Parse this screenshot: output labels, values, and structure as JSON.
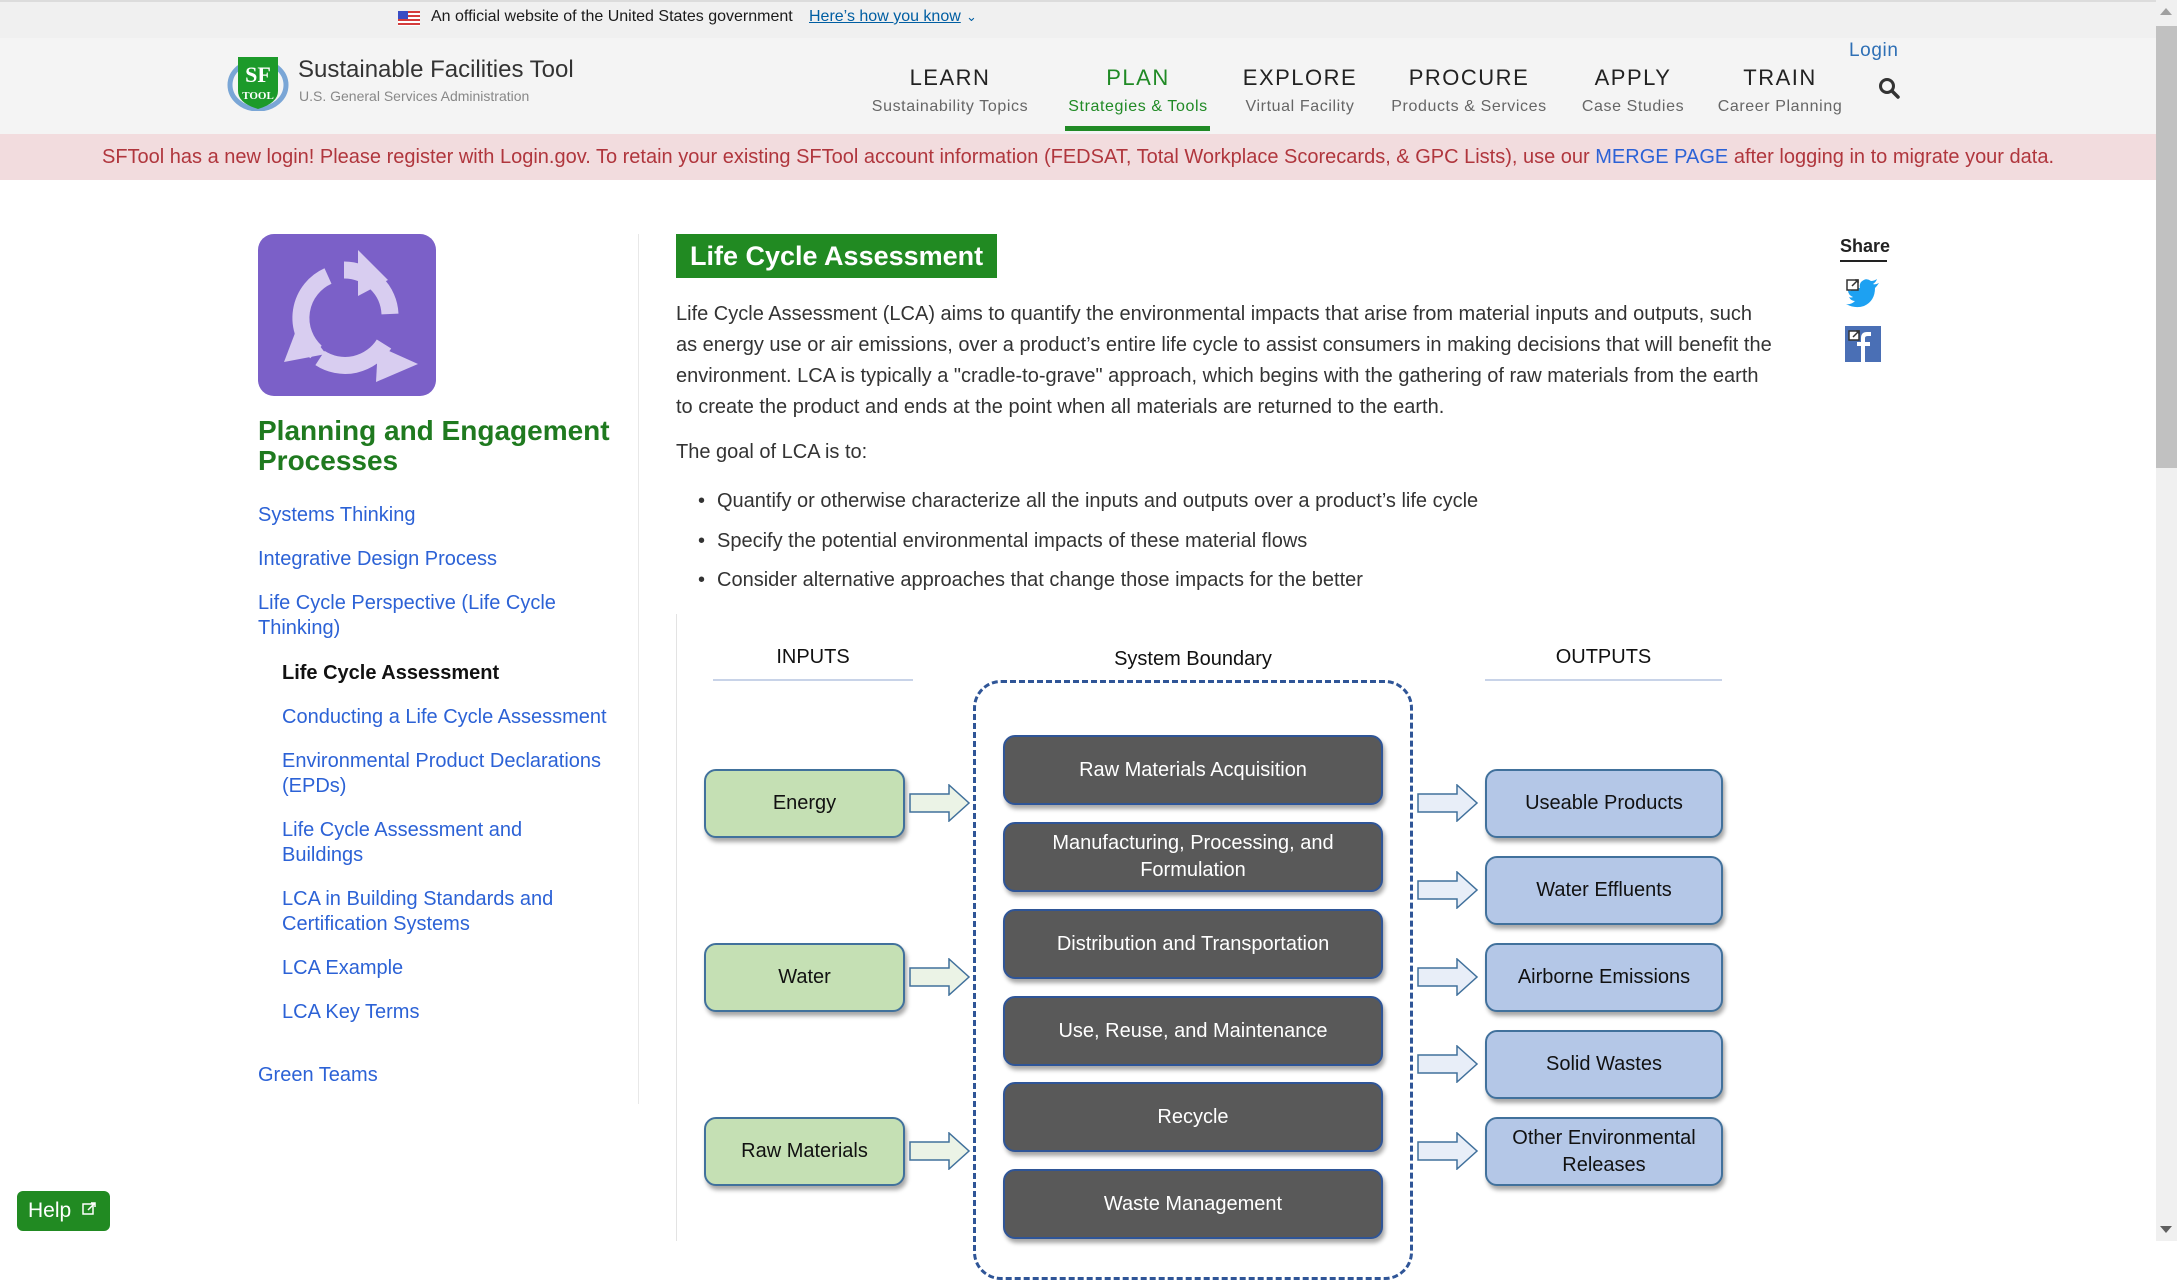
{
  "gov_banner": {
    "text": "An official website of the United States government",
    "link": "Here’s how you know",
    "chevron": "⌄"
  },
  "header": {
    "title": "Sustainable Facilities Tool",
    "subtitle": "U.S. General Services Administration",
    "login": "Login",
    "nav": [
      {
        "label": "LEARN",
        "sub": "Sustainability Topics"
      },
      {
        "label": "PLAN",
        "sub": "Strategies & Tools",
        "active": true
      },
      {
        "label": "EXPLORE",
        "sub": "Virtual Facility"
      },
      {
        "label": "PROCURE",
        "sub": "Products & Services"
      },
      {
        "label": "APPLY",
        "sub": "Case Studies"
      },
      {
        "label": "TRAIN",
        "sub": "Career Planning"
      }
    ]
  },
  "alert": {
    "text_before": "SFTool has a new login! Please register with Login.gov. To retain your existing SFTool account information (FEDSAT, Total Workplace Scorecards, & GPC Lists), use our ",
    "link": "MERGE PAGE",
    "text_after": " after logging in to migrate your data."
  },
  "sidebar": {
    "heading": "Planning and Engagement Processes",
    "items": [
      {
        "label": "Systems Thinking",
        "level": 1
      },
      {
        "label": "Integrative Design Process",
        "level": 1
      },
      {
        "label": "Life Cycle Perspective (Life Cycle Thinking)",
        "level": 1
      },
      {
        "label": "Life Cycle Assessment",
        "level": 2,
        "current": true
      },
      {
        "label": "Conducting a Life Cycle Assessment",
        "level": 2
      },
      {
        "label": "Environmental Product Declarations (EPDs)",
        "level": 2
      },
      {
        "label": "Life Cycle Assessment and Buildings",
        "level": 2
      },
      {
        "label": "LCA in Building Standards and Certification Systems",
        "level": 2
      },
      {
        "label": "LCA Example",
        "level": 2
      },
      {
        "label": "LCA Key Terms",
        "level": 2
      },
      {
        "label": "Green Teams",
        "level": 1
      }
    ]
  },
  "main": {
    "title": "Life Cycle Assessment",
    "intro": "Life Cycle Assessment (LCA) aims to quantify the environmental impacts that arise from material inputs and outputs, such as energy use or air emissions, over a product’s entire life cycle to assist consumers in making decisions that will benefit the environment. LCA is typically a \"cradle-to-grave\" approach, which begins with the gathering of raw materials from the earth to create the product and ends at the point when all materials are returned to the earth.",
    "goal_intro": "The goal of LCA is to:",
    "goals": [
      "Quantify or otherwise characterize all the inputs and outputs over a product’s life cycle",
      "Specify the potential environmental impacts of these material flows",
      "Consider alternative approaches that change those impacts for the better"
    ]
  },
  "share": {
    "label": "Share",
    "icons": [
      "twitter-icon",
      "facebook-icon"
    ]
  },
  "diagram": {
    "inputs_label": "INPUTS",
    "boundary_label": "System Boundary",
    "outputs_label": "OUTPUTS",
    "inputs": [
      "Energy",
      "Water",
      "Raw Materials"
    ],
    "stages": [
      "Raw Materials Acquisition",
      "Manufacturing, Processing, and Formulation",
      "Distribution and Transportation",
      "Use, Reuse, and Maintenance",
      "Recycle",
      "Waste Management"
    ],
    "outputs": [
      "Useable Products",
      "Water Effluents",
      "Airborne Emissions",
      "Solid Wastes",
      "Other Environmental Releases"
    ]
  },
  "help": {
    "label": "Help"
  },
  "colors": {
    "brand_green": "#218a22",
    "link_blue": "#2c62d6",
    "alert_bg": "#f2dcde",
    "alert_text": "#b0363d",
    "sidebar_icon_bg": "#7b60c8"
  }
}
